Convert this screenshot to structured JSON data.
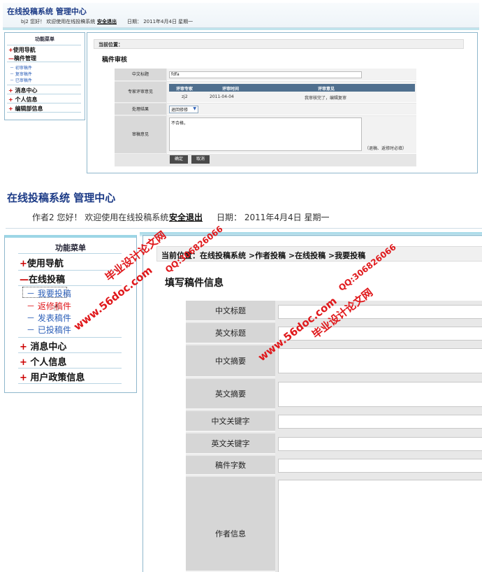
{
  "panel1": {
    "sys_title": "在线投稿系统 管理中心",
    "welcome": "bj2 您好！ 欢迎使用在线投稿系统",
    "logout": "安全退出",
    "date": "日期： 2011年4月4日 星期一",
    "menu_title": "功能菜单",
    "menu": {
      "nav": "使用导航",
      "manage": "稿件管理",
      "sub1": "初审稿件",
      "sub2": "复审稿件",
      "sub3": "已审稿件",
      "msg": "消息中心",
      "personal": "个人信息",
      "editorial": "编辑部信息"
    },
    "breadcrumb": "当前位置：",
    "page_title": "稿件审核",
    "form": {
      "cn_title_label": "中文标题",
      "cn_title_value": "fdfa",
      "expert_label": "专家评审意见",
      "review_headers": [
        "评审专家",
        "评审时间",
        "评审意见"
      ],
      "review_row": [
        "zj2",
        "2011-04-04",
        "我审核完了，编辑复审"
      ],
      "result_label": "处理结果",
      "result_value": "退回修修",
      "opinion_label": "审稿意见",
      "opinion_value": "不合格，",
      "note": "（退稿、返修时必填）",
      "confirm": "确定",
      "cancel": "取消"
    }
  },
  "panel2": {
    "sys_title": "在线投稿系统 管理中心",
    "welcome": "作者2 您好！ 欢迎使用在线投稿系统",
    "logout": "安全退出",
    "date": "日期： 2011年4月4日 星期一",
    "menu_title": "功能菜单",
    "menu": {
      "nav": "使用导航",
      "online": "在线投稿",
      "sub1": "我要投稿",
      "sub2": "返修稿件",
      "sub3": "发表稿件",
      "sub4": "已投稿件",
      "msg": "消息中心",
      "personal": "个人信息",
      "policy": "用户政策信息"
    },
    "breadcrumb": "当前位置：在线投稿系统 >作者投稿 >在线投稿 >我要投稿",
    "page_title": "填写稿件信息",
    "form": {
      "cn_title": "中文标题",
      "en_title": "英文标题",
      "cn_abstract": "中文摘要",
      "en_abstract": "英文摘要",
      "cn_keywords": "中文关键字",
      "en_keywords": "英文关键字",
      "word_count": "稿件字数",
      "author_info": "作者信息"
    }
  },
  "watermark": {
    "site": "www.56doc.com",
    "qq": "QQ:306826066",
    "name": "毕业设计论文网"
  },
  "colors": {
    "title_blue": "#1b3a86",
    "accent_red": "#cc0000",
    "link_blue": "#2c5fb8",
    "border_teal": "#8fb7cc"
  }
}
